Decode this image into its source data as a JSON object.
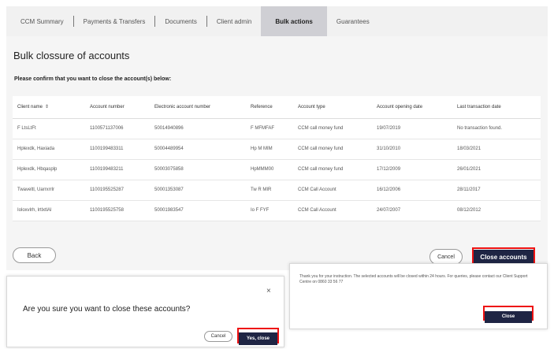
{
  "tabs": [
    {
      "label": "CCM Summary"
    },
    {
      "label": "Payments & Transfers"
    },
    {
      "label": "Documents"
    },
    {
      "label": "Client admin"
    },
    {
      "label": "Bulk actions"
    },
    {
      "label": "Guarantees"
    }
  ],
  "page": {
    "title": "Bulk clossure of accounts",
    "instruction": "Please confirm that you want to close the account(s) below:"
  },
  "table": {
    "columns": [
      "Client name",
      "Account number",
      "Electronic account number",
      "Reference",
      "Account type",
      "Account opening date",
      "Last transaction date"
    ],
    "sort_icon": "⇕",
    "rows": [
      [
        "F LtsLtFt",
        "1100571137006",
        "50014940896",
        "F MFMFAF",
        "CCM call money fund",
        "19/07/2019",
        "No transaction found."
      ],
      [
        "Hplexdk, Haxiada",
        "1100199483311",
        "50004489954",
        "Hp M MIM",
        "CCM call money fund",
        "31/10/2010",
        "18/03/2021"
      ],
      [
        "Hplexdk, Hbqasplp",
        "1100199483211",
        "50003075858",
        "HpMMM00",
        "CCM call money fund",
        "17/12/2009",
        "26/01/2021"
      ],
      [
        "Twaveltl, Uarrxrrlr",
        "1100195525287",
        "50001353087",
        "Tw R MIR",
        "CCM Call Account",
        "16/12/2006",
        "28/11/2017"
      ],
      [
        "Ioloxvlrh, lrtlxtlAl",
        "1100195525758",
        "50001983547",
        "Io F FYF",
        "CCM Call Account",
        "24/07/2007",
        "08/12/2012"
      ]
    ]
  },
  "buttons": {
    "back": "Back",
    "cancel": "Cancel",
    "close_accounts": "Close accounts"
  },
  "dialog": {
    "close_icon": "×",
    "question": "Are you sure you want to close these accounts?",
    "cancel": "Cancel",
    "confirm": "Yes, close"
  },
  "success": {
    "message": "Thank you for your instruction. The selected accounts will be closed within 24 hours. For queries, please contact our Client Support Centre on 0860 33 56 77",
    "close": "Close"
  },
  "colors": {
    "primary": "#1f2544",
    "highlight": "#e11111"
  }
}
